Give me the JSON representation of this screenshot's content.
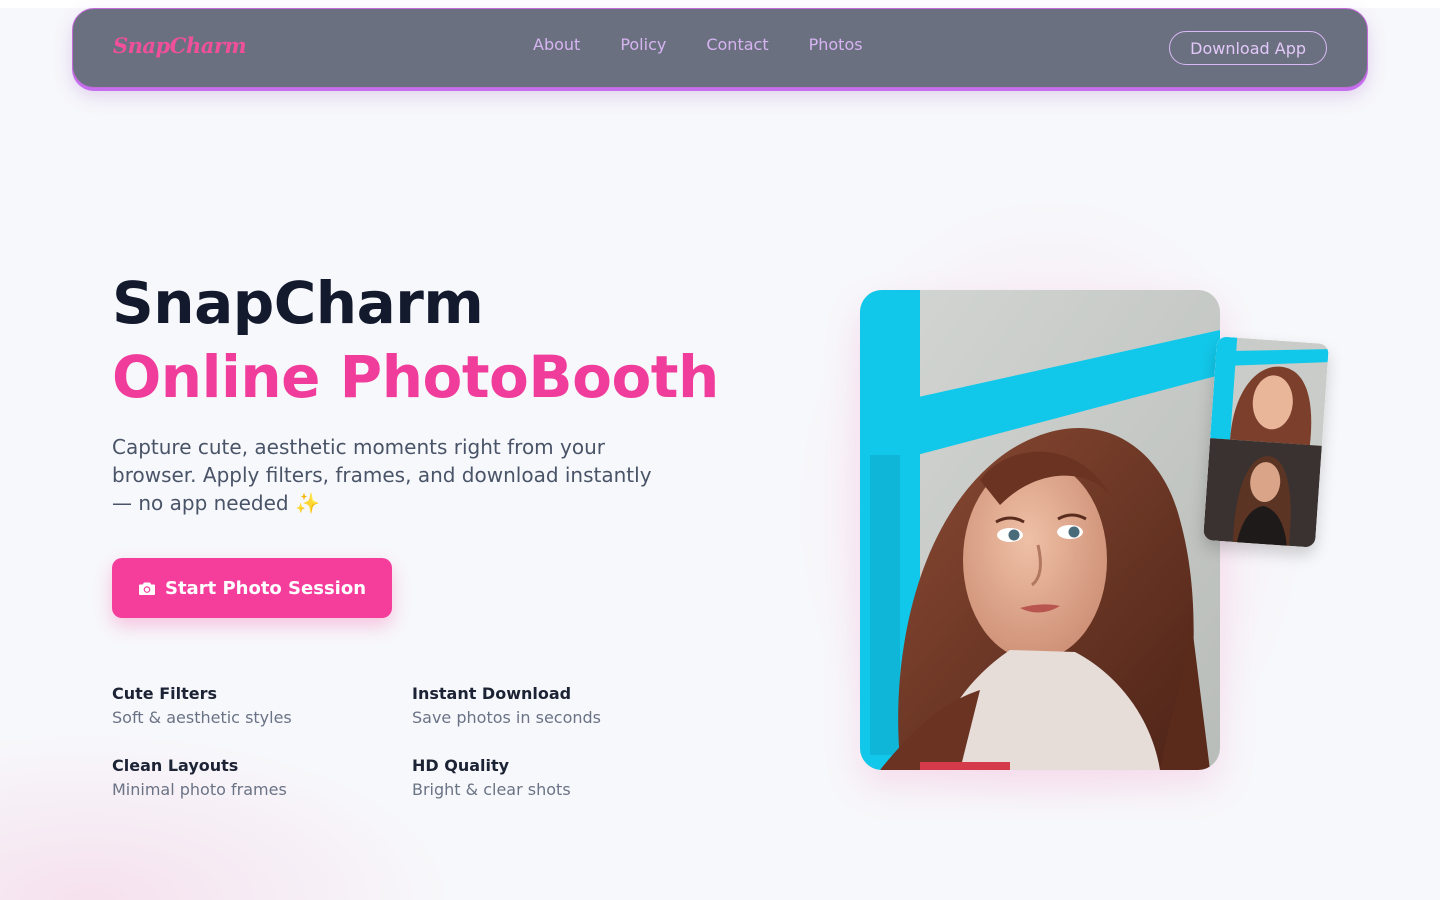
{
  "nav": {
    "logo": "SnapCharm",
    "links": [
      "About",
      "Policy",
      "Contact",
      "Photos"
    ],
    "download_label": "Download App"
  },
  "hero": {
    "title_line1": "SnapCharm",
    "title_line2": "Online PhotoBooth",
    "description": "Capture cute, aesthetic moments right from your browser. Apply filters, frames, and download instantly — no app needed ✨",
    "cta_label": "Start Photo Session",
    "cta_icon": "camera-icon"
  },
  "features": [
    {
      "title": "Cute Filters",
      "subtitle": "Soft & aesthetic styles"
    },
    {
      "title": "Instant Download",
      "subtitle": "Save photos in seconds"
    },
    {
      "title": "Clean Layouts",
      "subtitle": "Minimal photo frames"
    },
    {
      "title": "HD Quality",
      "subtitle": "Bright & clear shots"
    }
  ],
  "colors": {
    "accent": "#f53d9c",
    "navbar": "#6b7080",
    "nav_text": "#d6b4f2",
    "title_dark": "#141a2e"
  }
}
